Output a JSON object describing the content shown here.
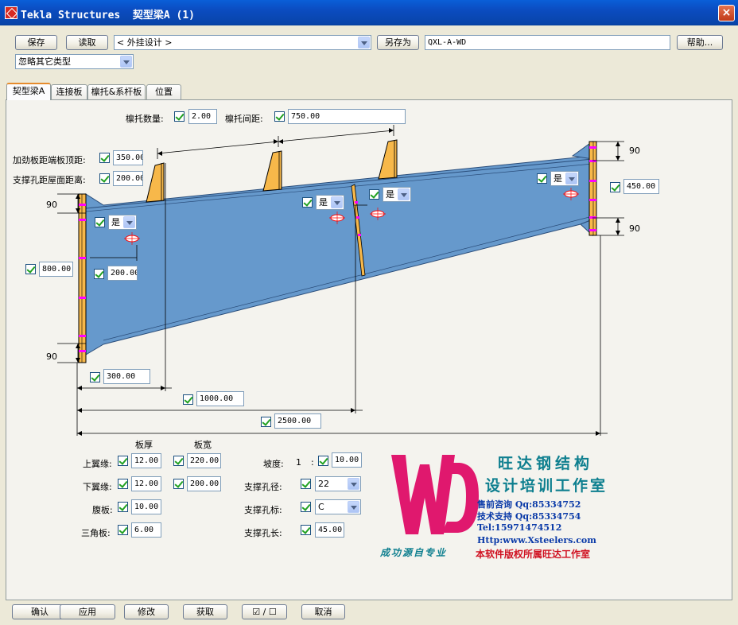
{
  "window": {
    "title": "Tekla Structures  契型梁A (1)",
    "close": "×"
  },
  "toolbar": {
    "save": "保存",
    "load": "读取",
    "attr_set": "< 外挂设计 >",
    "save_as": "另存为",
    "save_as_name": "QXL-A-WD",
    "help": "帮助...",
    "ignore_type": "忽略其它类型"
  },
  "tabs": [
    "契型梁A",
    "连接板",
    "檩托&系杆板",
    "位置"
  ],
  "diagram": {
    "purlin_count_label": "檩托数量:",
    "purlin_count": "2.00",
    "purlin_spacing_label": "檩托间距:",
    "purlin_spacing": "750.00",
    "stiffener_dist_label": "加劲板距端板顶距:",
    "stiffener_dist": "350.00",
    "brace_hole_dist_label": "支撑孔距屋面距离:",
    "brace_hole_dist": "200.00",
    "dim_top_left": "90",
    "dim_bottom_left": "90",
    "dim_top_right": "90",
    "dim_bottom_right": "90",
    "left_height": "800.00",
    "right_height": "450.00",
    "hole_offset": "200.00",
    "len_300": "300.00",
    "len_1000": "1000.00",
    "len_2500": "2500.00",
    "yes1": "是",
    "yes2": "是",
    "yes3": "是",
    "yes4": "是"
  },
  "plates": {
    "thickness_header": "板厚",
    "width_header": "板宽",
    "top_flange_label": "上翼缘:",
    "top_flange_t": "12.00",
    "top_flange_w": "220.00",
    "bottom_flange_label": "下翼缘:",
    "bottom_flange_t": "12.00",
    "bottom_flange_w": "200.00",
    "web_label": "腹板:",
    "web_t": "10.00",
    "triangle_label": "三角板:",
    "triangle_t": "6.00"
  },
  "slope": {
    "slope_label": "坡度:",
    "slope_ratio": "1",
    "slope_colon": ":",
    "slope_value": "10.00",
    "hole_dia_label": "支撑孔径:",
    "hole_dia": "22",
    "hole_std_label": "支撑孔标:",
    "hole_std": "C",
    "hole_len_label": "支撑孔长:",
    "hole_len": "45.00"
  },
  "watermark": {
    "letters": "WD",
    "name1": "旺达钢结构",
    "name2": "设计培训工作室",
    "qq1": "售前咨询 Qq:85334752",
    "qq2": "技术支持 Qq:85334754",
    "tel": "Tel:15971474512",
    "web": "Http:www.Xsteelers.com",
    "slogan": "成功源自专业",
    "copyright": "本软件版权所属旺达工作室"
  },
  "bottom": {
    "ok": "确认",
    "apply": "应用",
    "modify": "修改",
    "get": "获取",
    "toggle": "☑ / ☐",
    "cancel": "取消"
  },
  "colors": {
    "beam_fill": "#6699cc",
    "plate_fill": "#f7b84a",
    "hole_mark": "#ff00ff",
    "logo_pink": "#e0186e",
    "logo_teal": "#0e7f8f",
    "logo_blue": "#0a3aa8",
    "logo_red": "#d01020"
  }
}
